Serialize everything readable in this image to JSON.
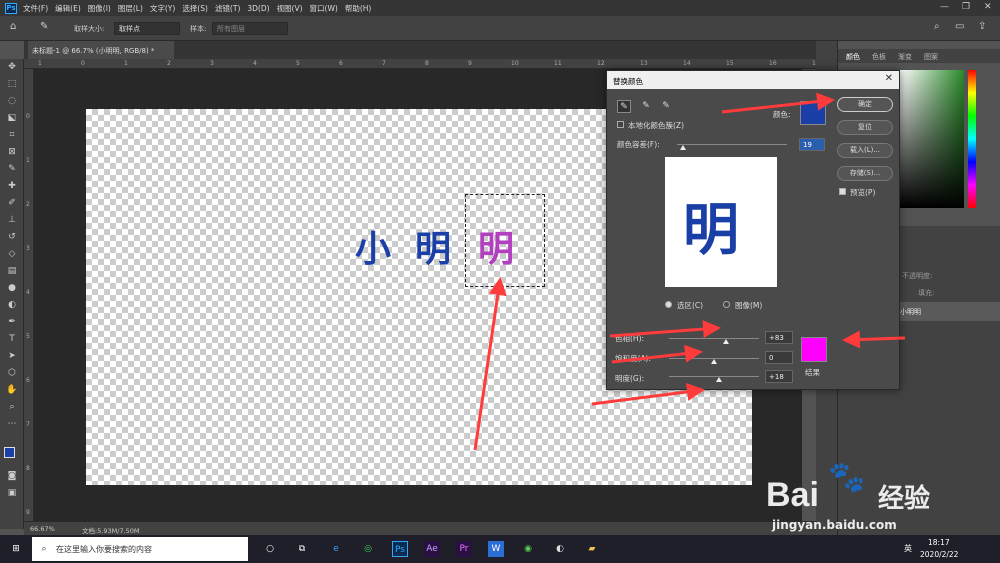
{
  "menubar": {
    "items": [
      "文件(F)",
      "编辑(E)",
      "图像(I)",
      "图层(L)",
      "文字(Y)",
      "选择(S)",
      "滤镜(T)",
      "3D(D)",
      "视图(V)",
      "窗口(W)",
      "帮助(H)"
    ]
  },
  "options": {
    "sample_size_label": "取样大小:",
    "sample_size_value": "取样点",
    "sample_label": "样本:",
    "sample_value": "所有图层"
  },
  "document": {
    "tab_title": "未标题-1 @ 66.7% (小明明, RGB/8) *",
    "text_part1": "小",
    "text_part2": "明",
    "text_part3": "明",
    "text_color_1": "#1a3fa6",
    "text_color_2": "#b23fbf"
  },
  "rulers": {
    "h": [
      "1",
      "0",
      "1",
      "2",
      "3",
      "4",
      "5",
      "6",
      "7",
      "8",
      "9",
      "10",
      "11",
      "12",
      "13",
      "14",
      "15",
      "16",
      "17"
    ],
    "v": [
      "0",
      "1",
      "2",
      "3",
      "4",
      "5",
      "6",
      "7",
      "8",
      "9"
    ]
  },
  "statusbar": {
    "zoom": "66.67%",
    "doc": "文档:5.93M/7.50M"
  },
  "dialog": {
    "title": "替换颜色",
    "localized_label": "本地化颜色簇(Z)",
    "color_label": "颜色:",
    "color_swatch": "#1a3fa6",
    "fuzziness_label": "颜色容差(F):",
    "fuzziness_value": "19",
    "preview_char": "明",
    "radio_selection": "选区(C)",
    "radio_image": "图像(M)",
    "hue_label": "色相(H):",
    "hue_value": "+83",
    "saturation_label": "饱和度(A):",
    "saturation_value": "0",
    "lightness_label": "明度(G):",
    "lightness_value": "+18",
    "result_label": "结果",
    "result_color": "#ff00ff",
    "buttons": {
      "ok": "确定",
      "reset": "复位",
      "load": "载入(L)...",
      "save": "存储(S)...",
      "preview": "预览(P)"
    },
    "slider_levels": {
      "fuzziness": 0.05,
      "hue": 0.63,
      "saturation": 0.5,
      "lightness": 0.55
    }
  },
  "right_panel": {
    "tabs": [
      "颜色",
      "色板",
      "渐变",
      "图案"
    ],
    "layer_name": "小明明",
    "opacity_label": "不透明度:",
    "fill_label": "填充:"
  },
  "taskbar": {
    "search_placeholder": "在这里输入你要搜索的内容",
    "time": "18:17",
    "date": "2020/2/22",
    "ime": "英"
  },
  "watermark": {
    "brand": "Bai",
    "brand2": "经验",
    "url": "jingyan.baidu.com"
  }
}
